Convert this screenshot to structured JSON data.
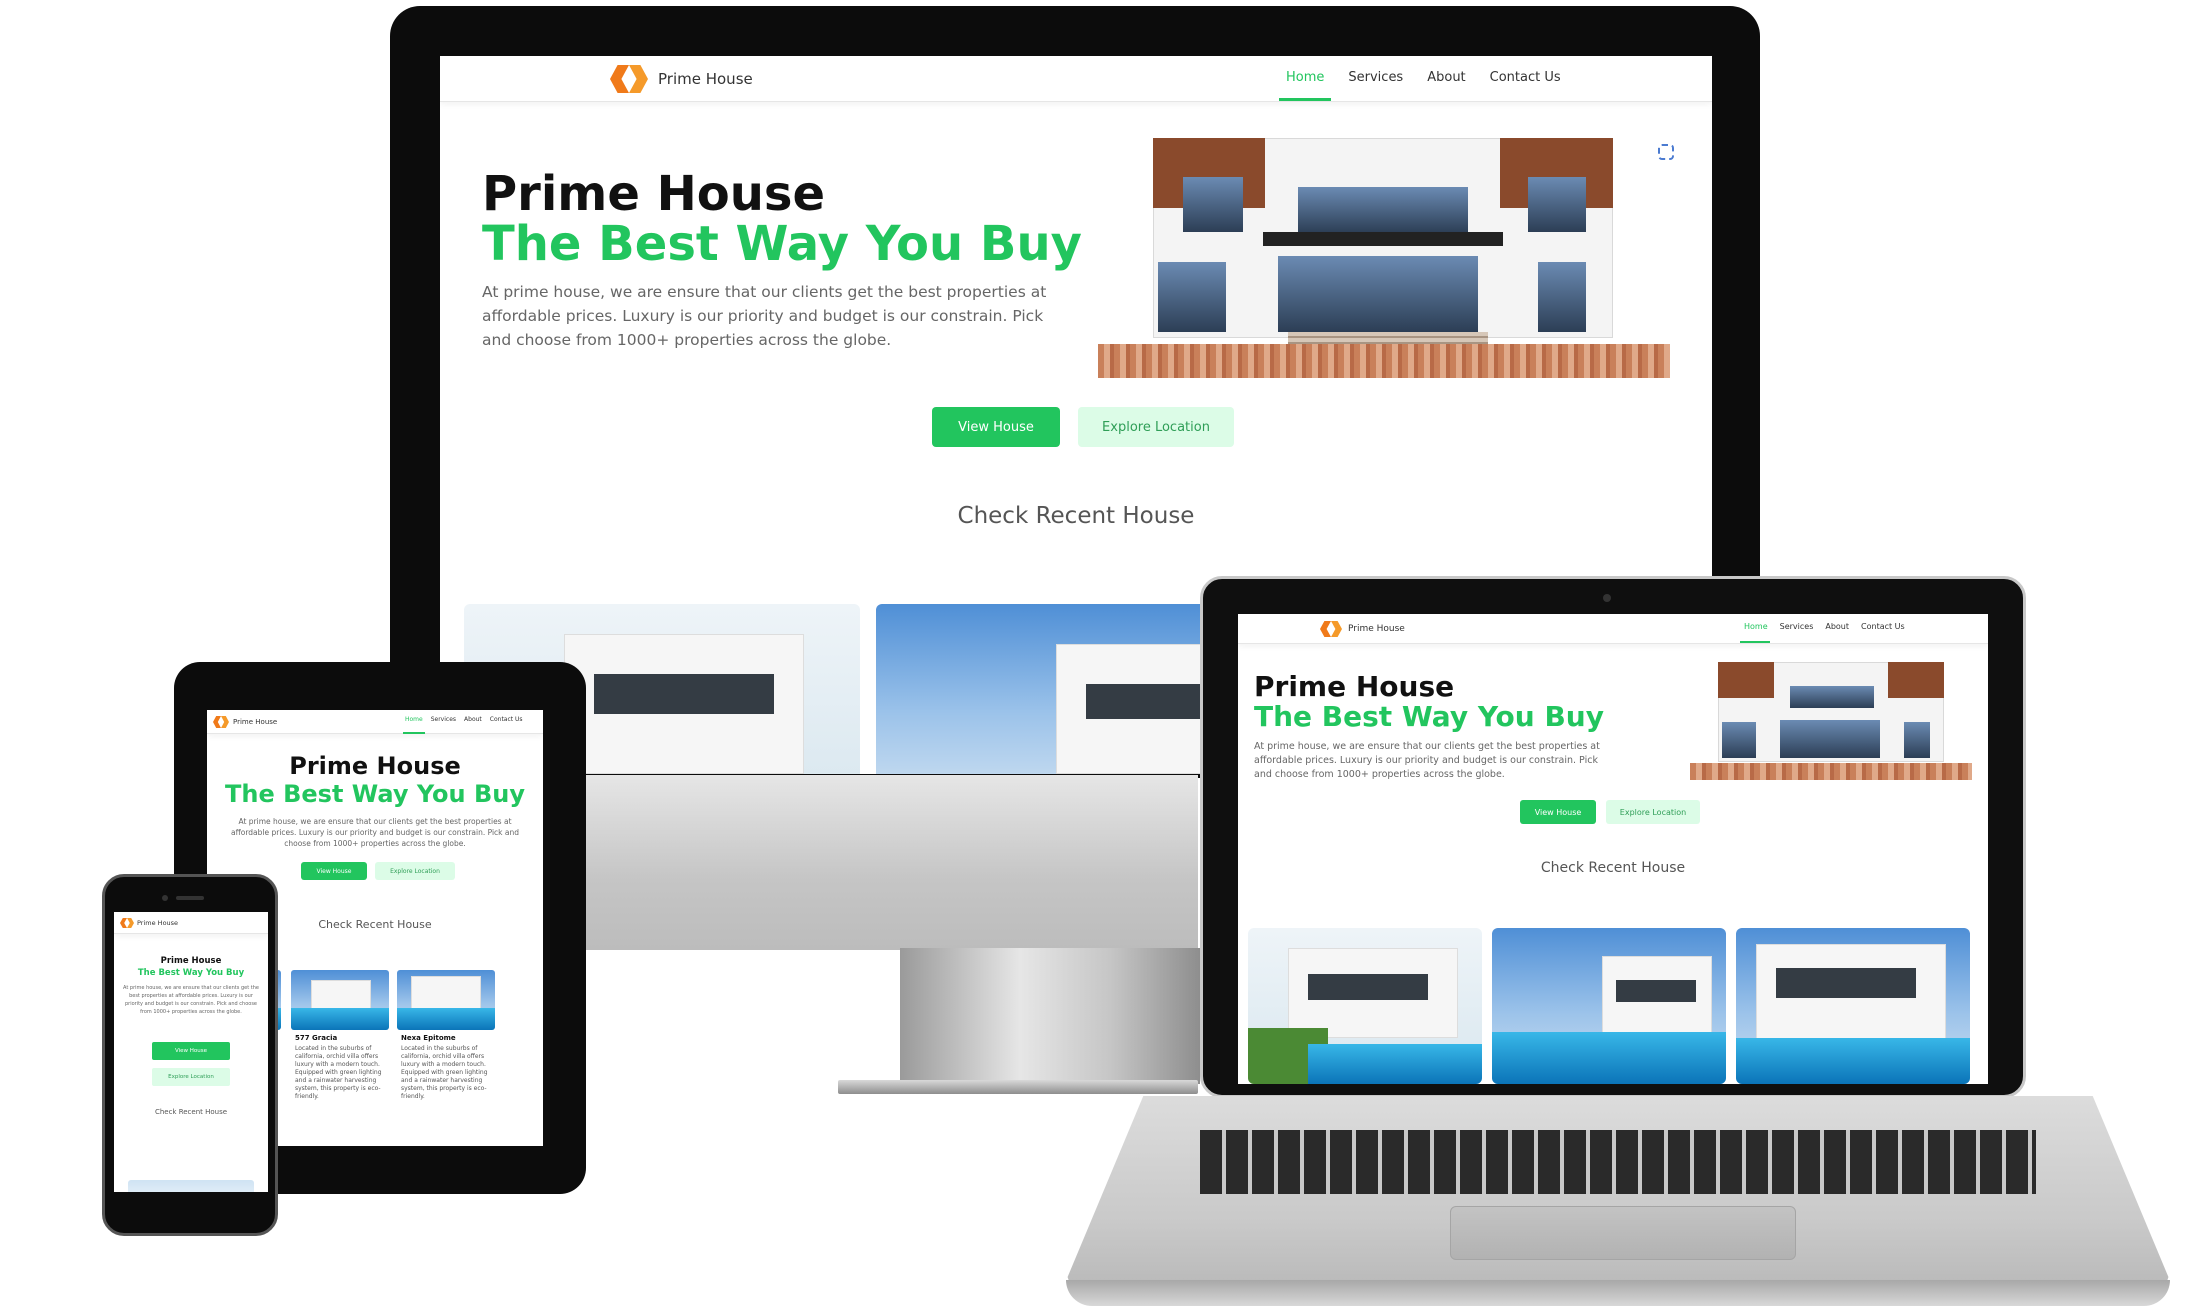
{
  "brand": {
    "name": "Prime House",
    "logo_icon": "diamond-logo-icon",
    "colors": {
      "accent": "#22c55e",
      "accent_light": "#dcfce7",
      "logo": "#f07a1a"
    }
  },
  "nav": {
    "items": [
      "Home",
      "Services",
      "About",
      "Contact Us"
    ],
    "active": "Home"
  },
  "hero": {
    "title_line1": "Prime House",
    "title_line2": "The Best Way You Buy",
    "description": "At prime house, we are ensure that our clients get the best properties at affordable prices. Luxury is our priority and budget is our constrain. Pick and choose from 1000+ properties across the globe.",
    "primary_button": "View House",
    "secondary_button": "Explore Location"
  },
  "recent": {
    "heading": "Check Recent House"
  },
  "properties": [
    {
      "name": "577 Gracia",
      "description": "Located in the suburbs of california, orchid villa offers luxury with a modern touch. Equipped with green lighting and a rainwater harvesting system, this property is eco-friendly."
    },
    {
      "name": "Nexa Epitome",
      "description": "Located in the suburbs of california, orchid villa offers luxury with a modern touch. Equipped with green lighting and a rainwater harvesting system, this property is eco-friendly."
    }
  ]
}
